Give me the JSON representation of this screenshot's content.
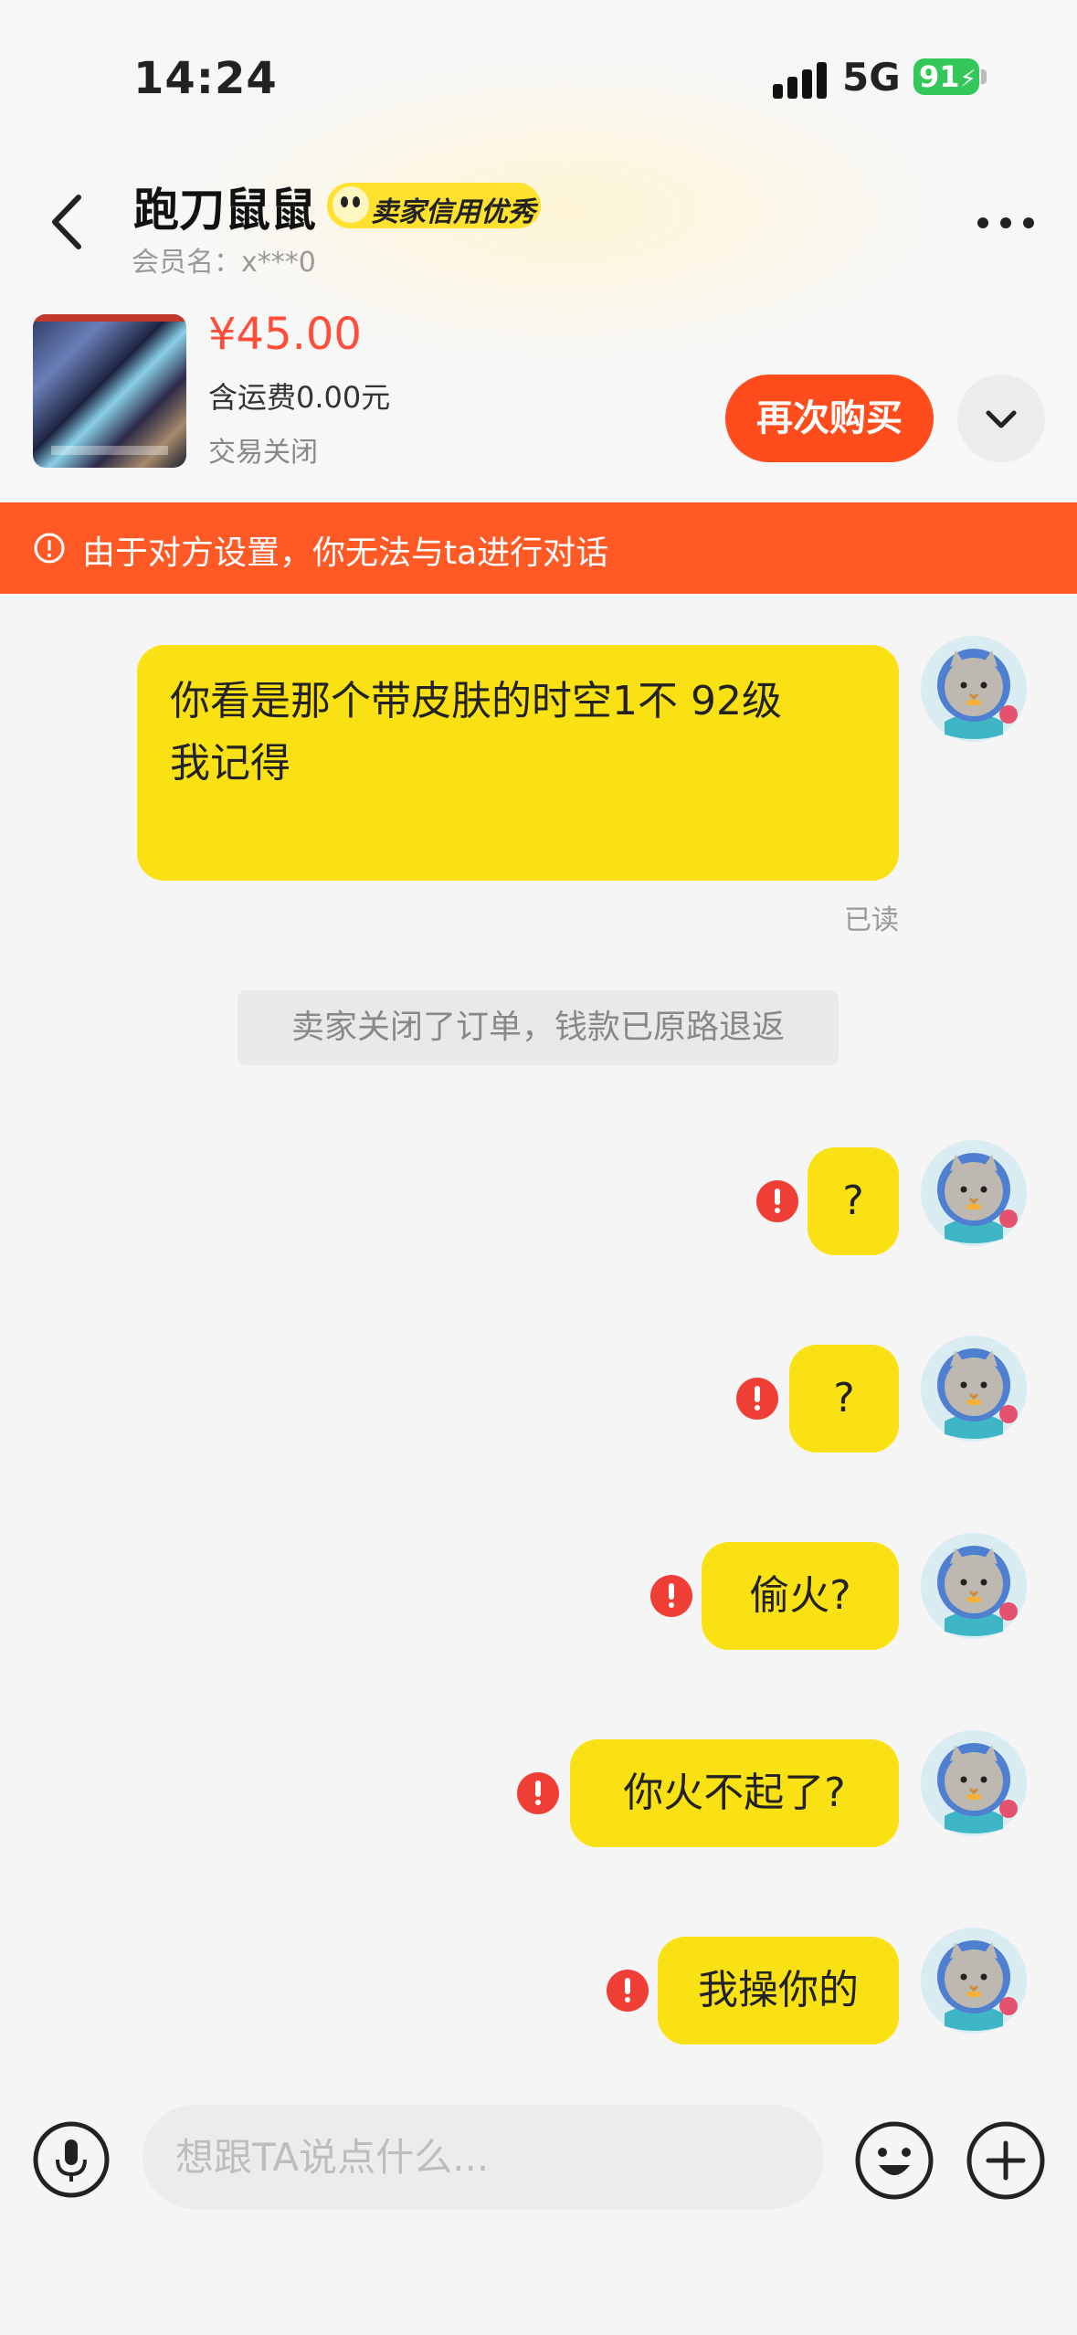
{
  "status_bar": {
    "time": "14:24",
    "network": "5G",
    "battery": "91"
  },
  "header": {
    "seller_name": "跑刀鼠鼠",
    "badge": "卖家信用优秀",
    "member": "会员名：x***0"
  },
  "product": {
    "price": "¥45.00",
    "shipping": "含运费0.00元",
    "trade_status": "交易关闭",
    "rebuy_label": "再次购买"
  },
  "banner": {
    "text": "由于对方设置，你无法与ta进行对话"
  },
  "chat": {
    "first_message_line1": "你看是那个带皮肤的时空1不 92级",
    "first_message_line2": "我记得",
    "read_status": "已读",
    "system_message": "卖家关闭了订单，钱款已原路退返",
    "failed_messages": [
      "?",
      "?",
      "偷火?",
      "你火不起了?",
      "我操你的"
    ]
  },
  "input": {
    "placeholder": "想跟TA说点什么..."
  },
  "colors": {
    "accent": "#ff4c1c",
    "bubble": "#f9e114",
    "error": "#ee3e35",
    "price": "#ff4d3a"
  },
  "icons": [
    "back-icon",
    "more-icon",
    "chevron-down-icon",
    "alert-icon",
    "error-icon",
    "microphone-icon",
    "emoji-icon",
    "plus-icon",
    "avatar"
  ]
}
